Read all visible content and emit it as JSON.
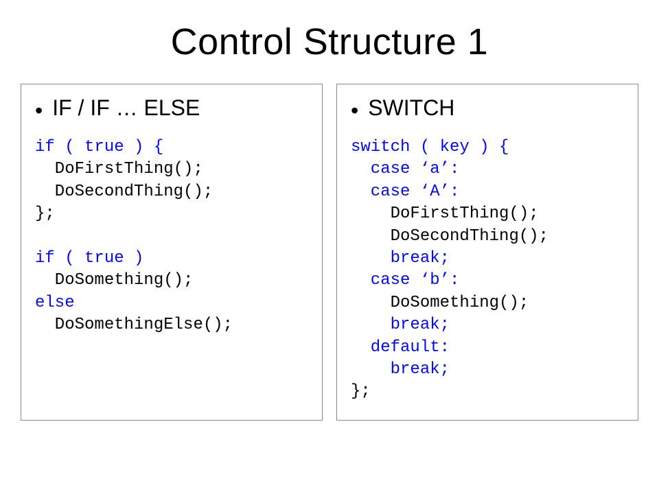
{
  "title": "Control Structure 1",
  "left": {
    "heading": "IF / IF … ELSE",
    "code": [
      {
        "t": "if ( true ) {",
        "kw": true
      },
      {
        "t": "  DoFirstThing();",
        "kw": false
      },
      {
        "t": "  DoSecondThing();",
        "kw": false
      },
      {
        "t": "};",
        "kw": false
      },
      {
        "t": "",
        "kw": false
      },
      {
        "t": "if ( true )",
        "kw": true
      },
      {
        "t": "  DoSomething();",
        "kw": false
      },
      {
        "t": "else",
        "kw": true
      },
      {
        "t": "  DoSomethingElse();",
        "kw": false
      }
    ]
  },
  "right": {
    "heading": "SWITCH",
    "code": [
      {
        "t": "switch ( key ) {",
        "kw": true
      },
      {
        "t": "  case ‘a’:",
        "kw": true
      },
      {
        "t": "  case ‘A’:",
        "kw": true
      },
      {
        "t": "    DoFirstThing();",
        "kw": false
      },
      {
        "t": "    DoSecondThing();",
        "kw": false
      },
      {
        "t": "    break;",
        "kw": true
      },
      {
        "t": "  case ‘b’:",
        "kw": true
      },
      {
        "t": "    DoSomething();",
        "kw": false
      },
      {
        "t": "    break;",
        "kw": true
      },
      {
        "t": "  default:",
        "kw": true
      },
      {
        "t": "    break;",
        "kw": true
      },
      {
        "t": "};",
        "kw": false
      }
    ]
  }
}
